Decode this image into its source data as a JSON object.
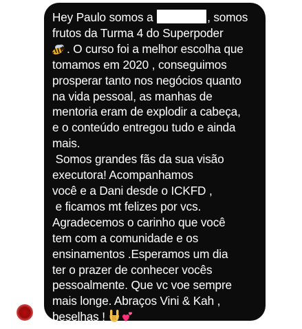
{
  "message": {
    "lines": [
      {
        "before": "Hey Paulo somos a ",
        "after": ", somos"
      },
      "frutos da Turma 4 do Superpoder",
      {
        "after": ". O curso foi a melhor escolha que"
      },
      "tomamos em 2020 , conseguimos",
      "prosperar tanto nos negócios quanto",
      "na vida pessoal, as manhas de",
      "mentoria eram de explodir a cabeça,",
      "e o conteúdo entregou tudo e ainda",
      "mais.",
      " Somos grandes fãs da sua visão",
      "executora! Acompanhamos",
      "você e a Dani desde o ICKFD ,",
      " e ficamos mt felizes por vcs.",
      "Agradecemos o carinho que você",
      "tem com a comunidade e os",
      "ensinamentos .Esperamos um dia",
      "ter o prazer de conhecer vocês",
      "pessoalmente. Que vc voe sempre",
      "mais longe. Abraços Vini & Kah ,",
      {
        "before": "beselhas ! "
      }
    ],
    "emojis": [
      "bee-emoji",
      "sign-of-horns-emoji",
      "revolving-hearts-emoji"
    ]
  },
  "colors": {
    "bubble": "#0c0c0c",
    "text": "#ffffff",
    "avatar": "#b30e0e"
  }
}
